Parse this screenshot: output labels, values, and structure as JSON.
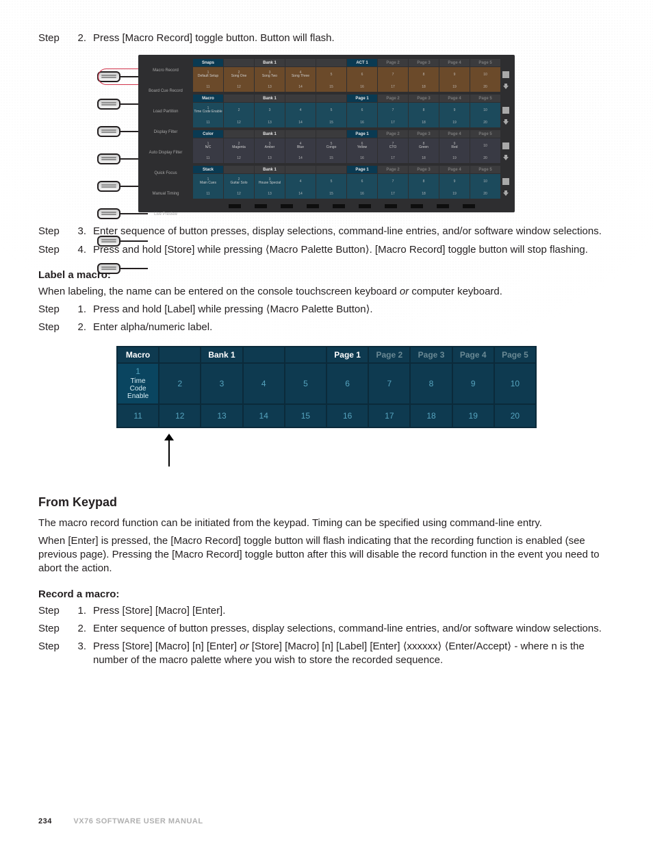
{
  "steps_top": [
    {
      "word": "Step",
      "num": "2.",
      "text": "Press [Macro Record] toggle button. Button will flash."
    }
  ],
  "console1": {
    "sideLabels": [
      "Macro Record",
      "Board Cue Record",
      "Load Partition",
      "Display Filter",
      "Auto Display Filter",
      "Quick Focus",
      "Manual Timing",
      "Live Preview"
    ],
    "panels": [
      {
        "name": "Snaps",
        "bank": "Bank 1",
        "act": "ACT 1",
        "pages": [
          "Page 2",
          "Page 3",
          "Page 4",
          "Page 5"
        ],
        "theme": "col-brown",
        "row1": [
          {
            "n": "1",
            "l": "Default Setup"
          },
          {
            "n": "2",
            "l": "Song One"
          },
          {
            "n": "3",
            "l": "Song Two"
          },
          {
            "n": "4",
            "l": "Song Three"
          },
          {
            "n": "5",
            "l": ""
          },
          {
            "n": "6",
            "l": ""
          },
          {
            "n": "7",
            "l": ""
          },
          {
            "n": "8",
            "l": ""
          },
          {
            "n": "9",
            "l": ""
          },
          {
            "n": "10",
            "l": ""
          }
        ],
        "row2": [
          "11",
          "12",
          "13",
          "14",
          "15",
          "16",
          "17",
          "18",
          "19",
          "20"
        ]
      },
      {
        "name": "Macro",
        "bank": "Bank 1",
        "act": "Page 1",
        "pages": [
          "Page 2",
          "Page 3",
          "Page 4",
          "Page 5"
        ],
        "theme": "col-teal",
        "row1": [
          {
            "n": "1",
            "l": "Time Code Enable"
          },
          {
            "n": "2",
            "l": ""
          },
          {
            "n": "3",
            "l": ""
          },
          {
            "n": "4",
            "l": ""
          },
          {
            "n": "5",
            "l": ""
          },
          {
            "n": "6",
            "l": ""
          },
          {
            "n": "7",
            "l": ""
          },
          {
            "n": "8",
            "l": ""
          },
          {
            "n": "9",
            "l": ""
          },
          {
            "n": "10",
            "l": ""
          }
        ],
        "row2": [
          "11",
          "12",
          "13",
          "14",
          "15",
          "16",
          "17",
          "18",
          "19",
          "20"
        ]
      },
      {
        "name": "Color",
        "bank": "Bank 1",
        "act": "Page 1",
        "pages": [
          "Page 2",
          "Page 3",
          "Page 4",
          "Page 5"
        ],
        "theme": "col-dark",
        "row1": [
          {
            "n": "1",
            "l": "N/C"
          },
          {
            "n": "2",
            "l": "Magenta"
          },
          {
            "n": "3",
            "l": "Amber"
          },
          {
            "n": "4",
            "l": "Blue"
          },
          {
            "n": "5",
            "l": "Congo"
          },
          {
            "n": "6",
            "l": "Yellow"
          },
          {
            "n": "7",
            "l": "CTO"
          },
          {
            "n": "8",
            "l": "Green"
          },
          {
            "n": "9",
            "l": "Red"
          },
          {
            "n": "10",
            "l": ""
          }
        ],
        "row2": [
          "11",
          "12",
          "13",
          "14",
          "15",
          "16",
          "17",
          "18",
          "19",
          "20"
        ]
      },
      {
        "name": "Stack",
        "bank": "Bank 1",
        "act": "Page 1",
        "pages": [
          "Page 2",
          "Page 3",
          "Page 4",
          "Page 5"
        ],
        "theme": "col-teal",
        "row1": [
          {
            "n": "1",
            "l": "Main Cues"
          },
          {
            "n": "2",
            "l": "Guitar Solo"
          },
          {
            "n": "3",
            "l": "House Special"
          },
          {
            "n": "4",
            "l": ""
          },
          {
            "n": "5",
            "l": ""
          },
          {
            "n": "6",
            "l": ""
          },
          {
            "n": "7",
            "l": ""
          },
          {
            "n": "8",
            "l": ""
          },
          {
            "n": "9",
            "l": ""
          },
          {
            "n": "10",
            "l": ""
          }
        ],
        "row2": [
          "11",
          "12",
          "13",
          "14",
          "15",
          "16",
          "17",
          "18",
          "19",
          "20"
        ]
      }
    ]
  },
  "steps_mid": [
    {
      "word": "Step",
      "num": "3.",
      "text": "Enter sequence of button presses, display selections, command-line entries, and/or software window selections."
    },
    {
      "word": "Step",
      "num": "4.",
      "text": "Press and hold [Store] while pressing ⟨Macro Palette Button⟩. [Macro Record] toggle button will stop flashing."
    }
  ],
  "label_macro_heading": "Label a macro:",
  "label_macro_intro_a": "When labeling, the name can be entered on the console touchscreen keyboard ",
  "label_macro_intro_or": "or",
  "label_macro_intro_b": " computer keyboard.",
  "steps_label": [
    {
      "word": "Step",
      "num": "1.",
      "text": "Press and hold [Label] while pressing ⟨Macro Palette Button⟩."
    },
    {
      "word": "Step",
      "num": "2.",
      "text": "Enter alpha/numeric label."
    }
  ],
  "console2": {
    "hdr": [
      "Macro",
      "",
      "Bank 1",
      "",
      "",
      "Page 1",
      "Page 2",
      "Page 3",
      "Page 4",
      "Page 5"
    ],
    "row1": [
      {
        "n": "1",
        "sub": "Time Code Enable",
        "sel": true
      },
      {
        "n": "2"
      },
      {
        "n": "3"
      },
      {
        "n": "4"
      },
      {
        "n": "5"
      },
      {
        "n": "6"
      },
      {
        "n": "7"
      },
      {
        "n": "8"
      },
      {
        "n": "9"
      },
      {
        "n": "10"
      }
    ],
    "row2": [
      "11",
      "12",
      "13",
      "14",
      "15",
      "16",
      "17",
      "18",
      "19",
      "20"
    ]
  },
  "from_keypad_heading": "From Keypad",
  "fk_p1": "The macro record function can be initiated from the keypad.  Timing can be specified using command-line entry.",
  "fk_p2": "When [Enter] is pressed, the [Macro Record] toggle button will flash indicating that the recording function is enabled (see previous page). Pressing the [Macro Record] toggle button after this will disable the record function in the event you need to abort the action.",
  "record_heading": "Record a macro:",
  "steps_record": [
    {
      "word": "Step",
      "num": "1.",
      "text": "Press [Store] [Macro] [Enter]."
    },
    {
      "word": "Step",
      "num": "2.",
      "text": "Enter sequence of button presses, display selections, command-line entries, and/or software window selections."
    },
    {
      "word": "Step",
      "num": "3.",
      "text_a": "Press [Store] [Macro] [n] [Enter] ",
      "text_or": "or",
      "text_b": " [Store] [Macro] [n] [Label] [Enter] ⟨xxxxxx⟩ ⟨Enter/Accept⟩ - where n is the number of the macro palette where you wish to store the recorded sequence."
    }
  ],
  "footer": {
    "page": "234",
    "title": "VX76 SOFTWARE USER MANUAL"
  }
}
